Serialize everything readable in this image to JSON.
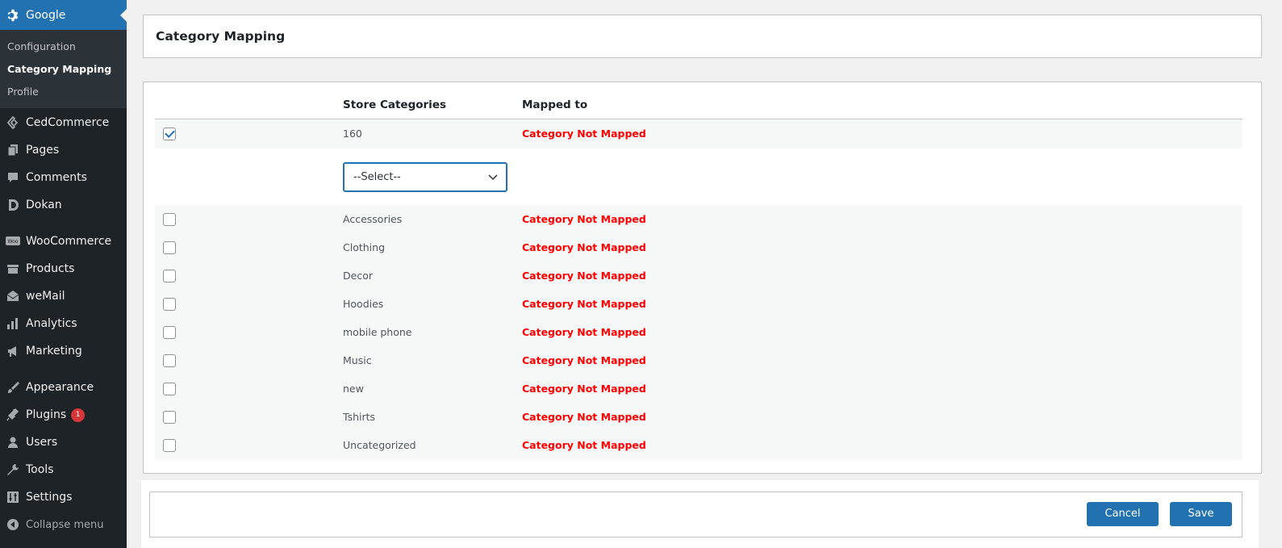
{
  "sidebar": {
    "active": "Google",
    "submenu": [
      "Configuration",
      "Category Mapping",
      "Profile"
    ],
    "items": [
      {
        "label": "CedCommerce",
        "icon": "cedcommerce-icon"
      },
      {
        "label": "Pages",
        "icon": "pages-icon"
      },
      {
        "label": "Comments",
        "icon": "comments-icon"
      },
      {
        "label": "Dokan",
        "icon": "dokan-icon"
      },
      {
        "label": "WooCommerce",
        "icon": "woocommerce-icon"
      },
      {
        "label": "Products",
        "icon": "products-icon"
      },
      {
        "label": "weMail",
        "icon": "wemail-icon"
      },
      {
        "label": "Analytics",
        "icon": "analytics-icon"
      },
      {
        "label": "Marketing",
        "icon": "marketing-icon"
      },
      {
        "label": "Appearance",
        "icon": "appearance-icon"
      },
      {
        "label": "Plugins",
        "icon": "plugins-icon",
        "badge": "1"
      },
      {
        "label": "Users",
        "icon": "users-icon"
      },
      {
        "label": "Tools",
        "icon": "tools-icon"
      },
      {
        "label": "Settings",
        "icon": "settings-icon"
      }
    ],
    "collapse": "Collapse menu"
  },
  "page": {
    "title": "Category Mapping"
  },
  "table": {
    "headers": [
      "Store Categories",
      "Mapped to"
    ],
    "first_row": {
      "category": "160",
      "mapped": "Category Not Mapped",
      "checked": true
    },
    "select_value": "--Select--",
    "rows": [
      {
        "category": "Accessories",
        "mapped": "Category Not Mapped"
      },
      {
        "category": "Clothing",
        "mapped": "Category Not Mapped"
      },
      {
        "category": "Decor",
        "mapped": "Category Not Mapped"
      },
      {
        "category": "Hoodies",
        "mapped": "Category Not Mapped"
      },
      {
        "category": "mobile phone",
        "mapped": "Category Not Mapped"
      },
      {
        "category": "Music",
        "mapped": "Category Not Mapped"
      },
      {
        "category": "new",
        "mapped": "Category Not Mapped"
      },
      {
        "category": "Tshirts",
        "mapped": "Category Not Mapped"
      },
      {
        "category": "Uncategorized",
        "mapped": "Category Not Mapped"
      }
    ]
  },
  "footer": {
    "cancel": "Cancel",
    "save": "Save"
  },
  "colors": {
    "accent": "#2271b1",
    "sidebar": "#1d2327",
    "error": "#ff0000"
  }
}
